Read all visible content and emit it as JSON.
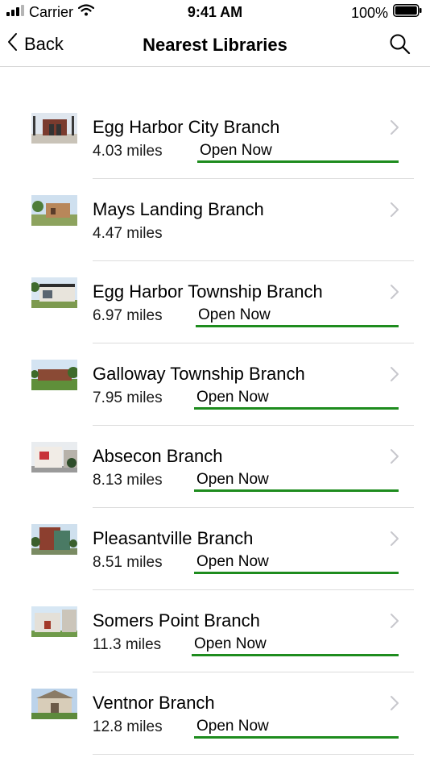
{
  "status_bar": {
    "carrier": "Carrier",
    "time": "9:41 AM",
    "battery": "100%"
  },
  "nav": {
    "back_label": "Back",
    "title": "Nearest Libraries"
  },
  "libraries": [
    {
      "name": "Egg Harbor City Branch",
      "distance": "4.03 miles",
      "status": "Open Now"
    },
    {
      "name": "Mays Landing Branch",
      "distance": "4.47 miles",
      "status": ""
    },
    {
      "name": "Egg Harbor Township Branch",
      "distance": "6.97 miles",
      "status": "Open Now"
    },
    {
      "name": "Galloway Township Branch",
      "distance": "7.95 miles",
      "status": "Open Now"
    },
    {
      "name": "Absecon Branch",
      "distance": "8.13 miles",
      "status": "Open Now"
    },
    {
      "name": "Pleasantville Branch",
      "distance": "8.51 miles",
      "status": "Open Now"
    },
    {
      "name": "Somers Point Branch",
      "distance": "11.3 miles",
      "status": "Open Now"
    },
    {
      "name": "Ventnor Branch",
      "distance": "12.8 miles",
      "status": "Open Now"
    }
  ],
  "colors": {
    "open_underline": "#1e8c1e",
    "divider": "#dcdcdc",
    "chevron": "#c7c7cc"
  },
  "icons": {
    "signal": "signal-icon",
    "wifi": "wifi-icon",
    "battery": "battery-icon",
    "back": "chevron-left-icon",
    "search": "search-icon",
    "row_chevron": "chevron-right-icon"
  }
}
